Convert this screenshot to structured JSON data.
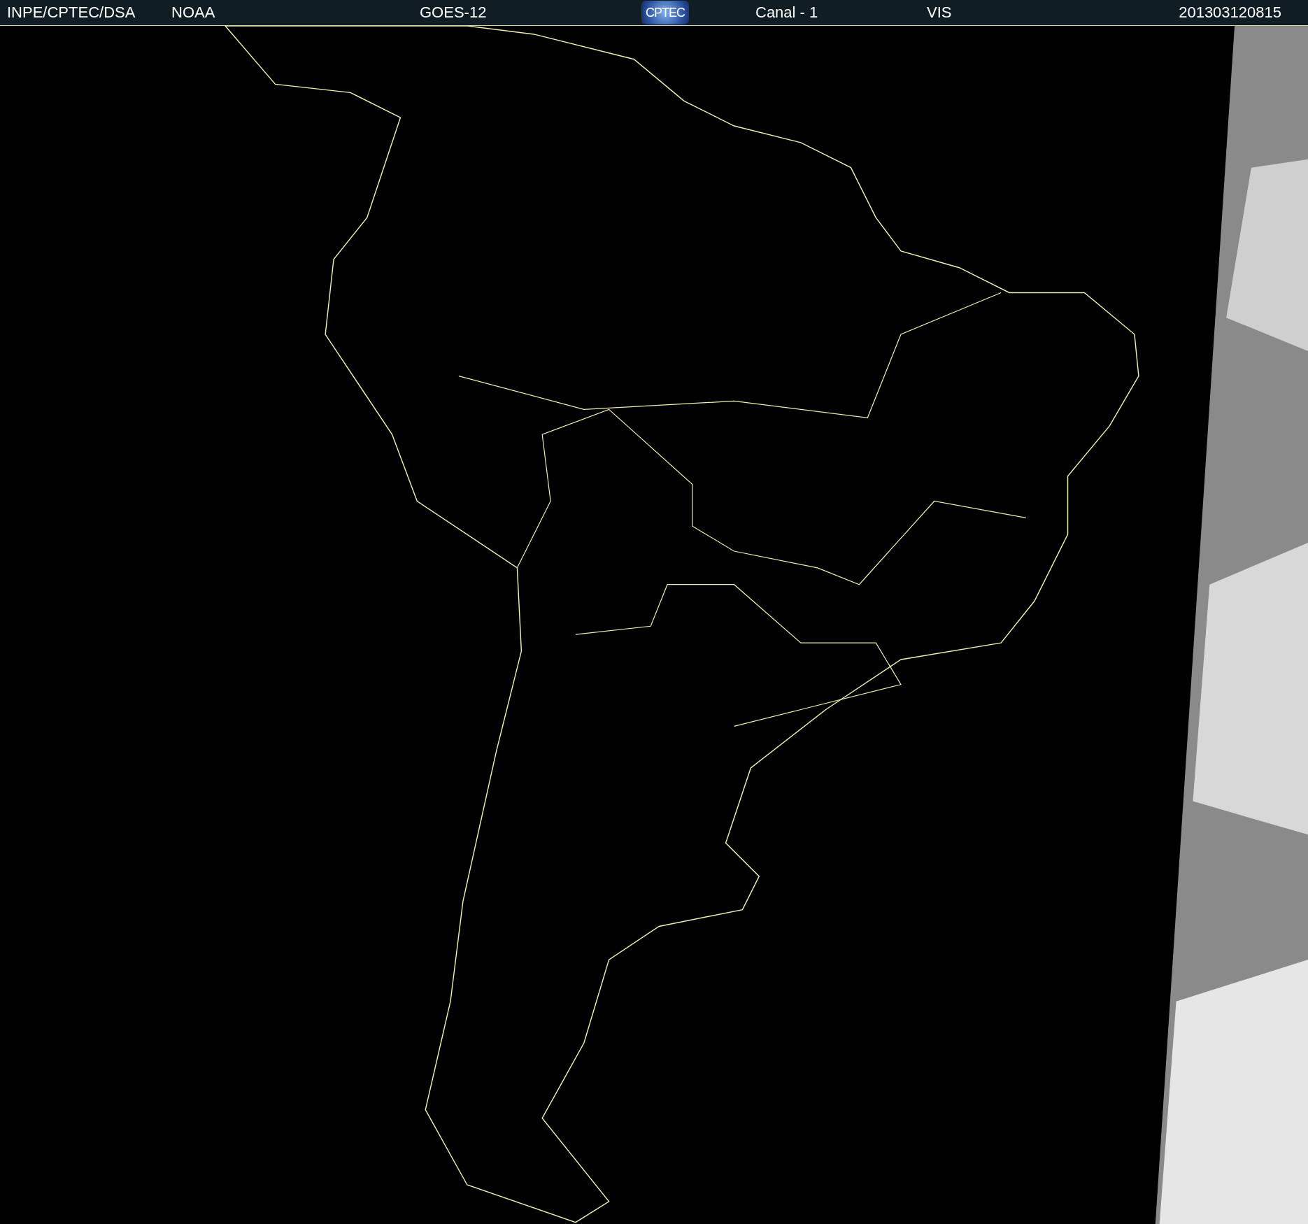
{
  "header": {
    "items": [
      {
        "kind": "text",
        "text": "INPE/CPTEC/DSA"
      },
      {
        "kind": "text",
        "text": "NOAA"
      },
      {
        "kind": "text",
        "text": "GOES-12"
      },
      {
        "kind": "logo",
        "text": "CPTEC"
      },
      {
        "kind": "text",
        "text": "Canal - 1"
      },
      {
        "kind": "text",
        "text": "VIS"
      },
      {
        "kind": "text",
        "text": "201303120815"
      }
    ]
  }
}
